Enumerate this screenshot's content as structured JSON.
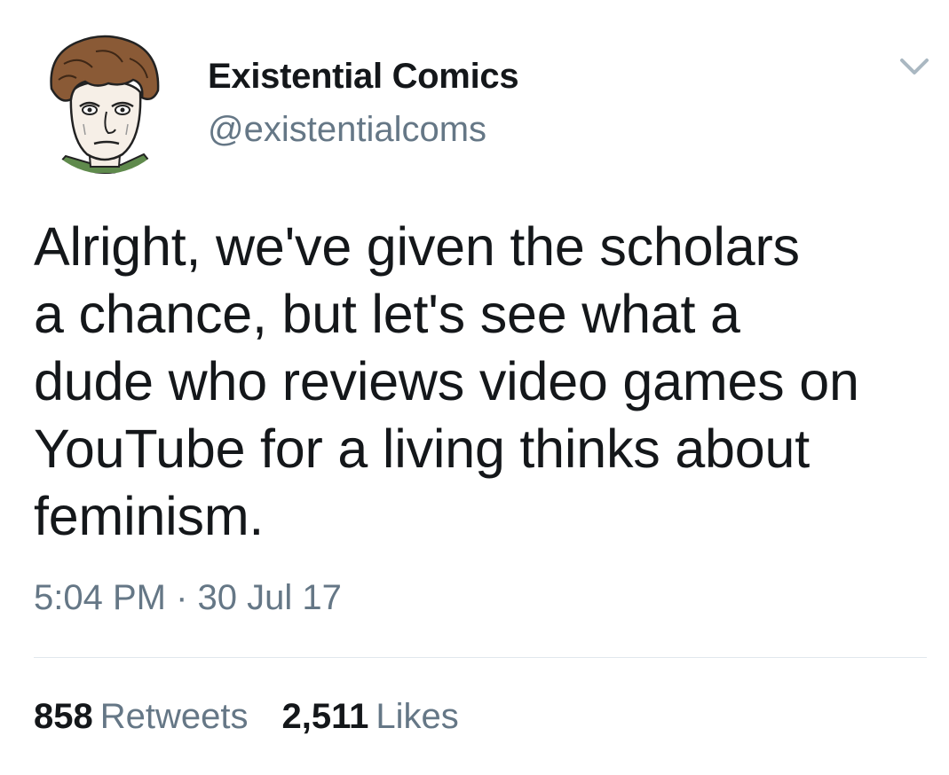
{
  "author": {
    "name": "Existential Comics",
    "handle": "@existentialcoms"
  },
  "tweet": {
    "text": "Alright, we've given the scholars\na chance, but let's see what a\ndude who reviews video games on\nYouTube for a living thinks about\nfeminism.",
    "timestamp": "5:04 PM · 30 Jul 17"
  },
  "stats": {
    "retweets_count": "858",
    "retweets_label": "Retweets",
    "likes_count": "2,511",
    "likes_label": "Likes"
  },
  "icons": {
    "menu": "chevron-down-icon",
    "avatar": "cartoon-portrait"
  },
  "colors": {
    "text_primary": "#14171a",
    "text_secondary": "#657786",
    "divider": "#e1e8ed",
    "caret": "#aab8c2"
  }
}
